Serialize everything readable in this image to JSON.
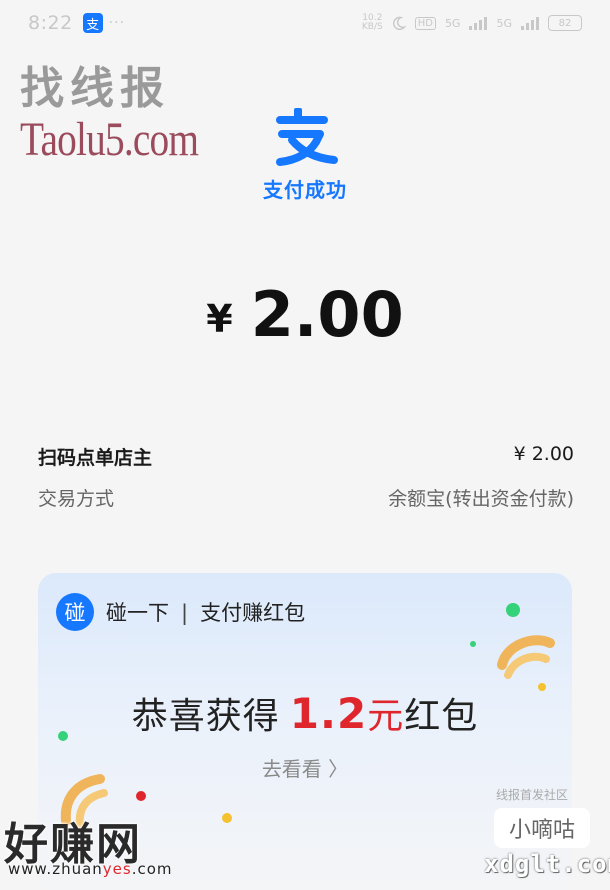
{
  "status_bar": {
    "time": "8:22",
    "app_badge": "支",
    "more": "···",
    "net_rate_top": "10.2",
    "net_rate_bottom": "KB/S",
    "hd": "HD",
    "network_1": "5G",
    "network_2": "5G",
    "battery": "82"
  },
  "watermarks": {
    "top_title": "找线报",
    "top_site": "Taolu5.com",
    "bottom_left": "好赚网",
    "bottom_left_url_prefix": "www.zhuan",
    "bottom_left_url_highlight": "yes",
    "bottom_left_url_suffix": ".com",
    "bottom_right_small": "线报首发社区",
    "bottom_right_box": "小嘀咕",
    "bottom_right_url": "xdglt.com"
  },
  "payment": {
    "logo_glyph": "支",
    "status": "支付成功",
    "currency": "¥",
    "amount": "2.00"
  },
  "details": {
    "merchant_label": "扫码点单店主",
    "merchant_value": "¥ 2.00",
    "method_label": "交易方式",
    "method_value": "余额宝(转出资金付款)"
  },
  "promo_card": {
    "badge": "碰",
    "title": "碰一下",
    "separator": "|",
    "subtitle": "支付赚红包",
    "congrats_prefix": "恭喜获得",
    "reward_amount": "1.2",
    "reward_unit": "元",
    "reward_suffix": "红包",
    "view_button": "去看看 〉"
  },
  "colors": {
    "accent": "#1677ff",
    "reward": "#e0262d"
  }
}
